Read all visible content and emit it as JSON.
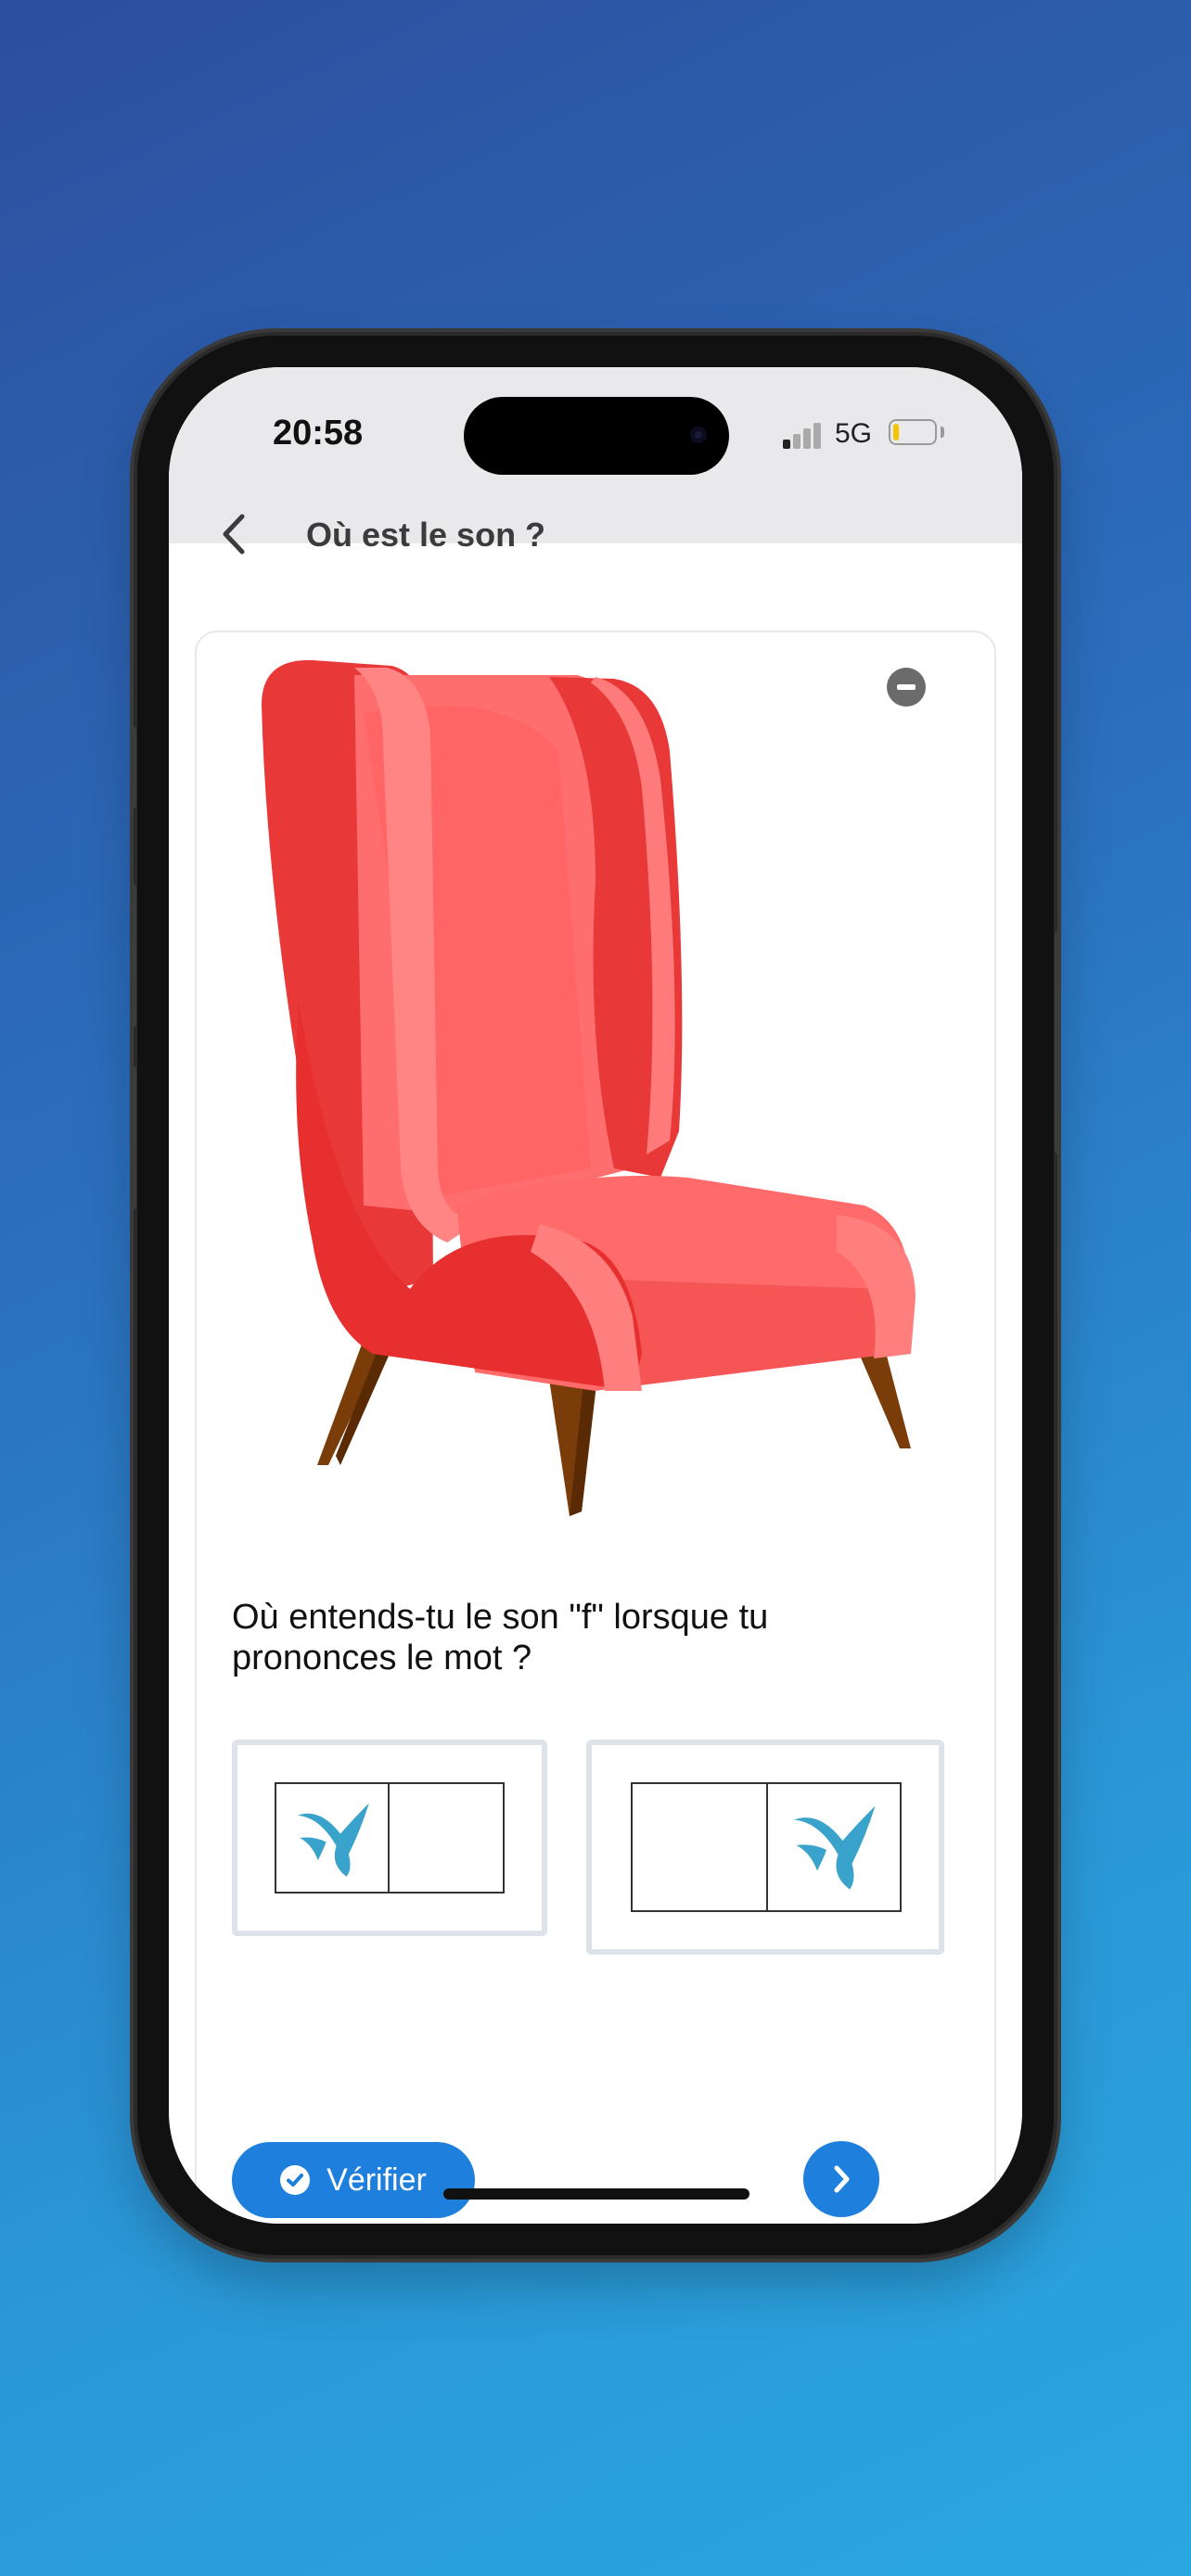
{
  "status_bar": {
    "time": "20:58",
    "network": "5G"
  },
  "header": {
    "title": "Où est le son ?"
  },
  "exercise": {
    "question": "Où entends-tu le son \"f\" lorsque tu prononces le mot ?",
    "options": [
      {
        "mark_position": "left"
      },
      {
        "mark_position": "right"
      }
    ]
  },
  "actions": {
    "verify_label": "Vérifier"
  },
  "colors": {
    "accent": "#1f7fdc",
    "mark": "#3aa3cc",
    "chair_red": "#e83838",
    "chair_light": "#ff7070",
    "legs": "#7a3c08"
  }
}
